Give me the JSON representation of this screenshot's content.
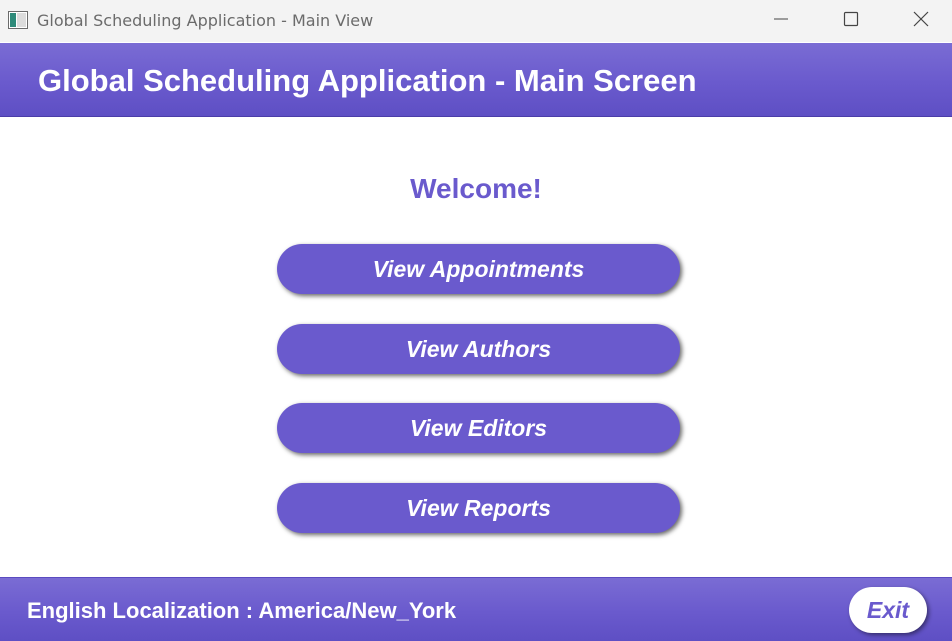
{
  "window": {
    "title": "Global Scheduling Application - Main View",
    "icon": "app-window-icon",
    "controls": [
      "minimize-icon",
      "maximize-icon",
      "close-icon"
    ]
  },
  "header": {
    "title": "Global Scheduling Application - Main Screen"
  },
  "main": {
    "welcome": "Welcome!",
    "buttons": [
      {
        "label": "View Appointments"
      },
      {
        "label": "View Authors"
      },
      {
        "label": "View Editors"
      },
      {
        "label": "View Reports"
      }
    ]
  },
  "footer": {
    "status": "English Localization : America/New_York",
    "exit_label": "Exit"
  },
  "colors": {
    "accent": "#6a5acd",
    "header_text": "#ffffff",
    "titlebar_bg": "#f3f3f3"
  }
}
